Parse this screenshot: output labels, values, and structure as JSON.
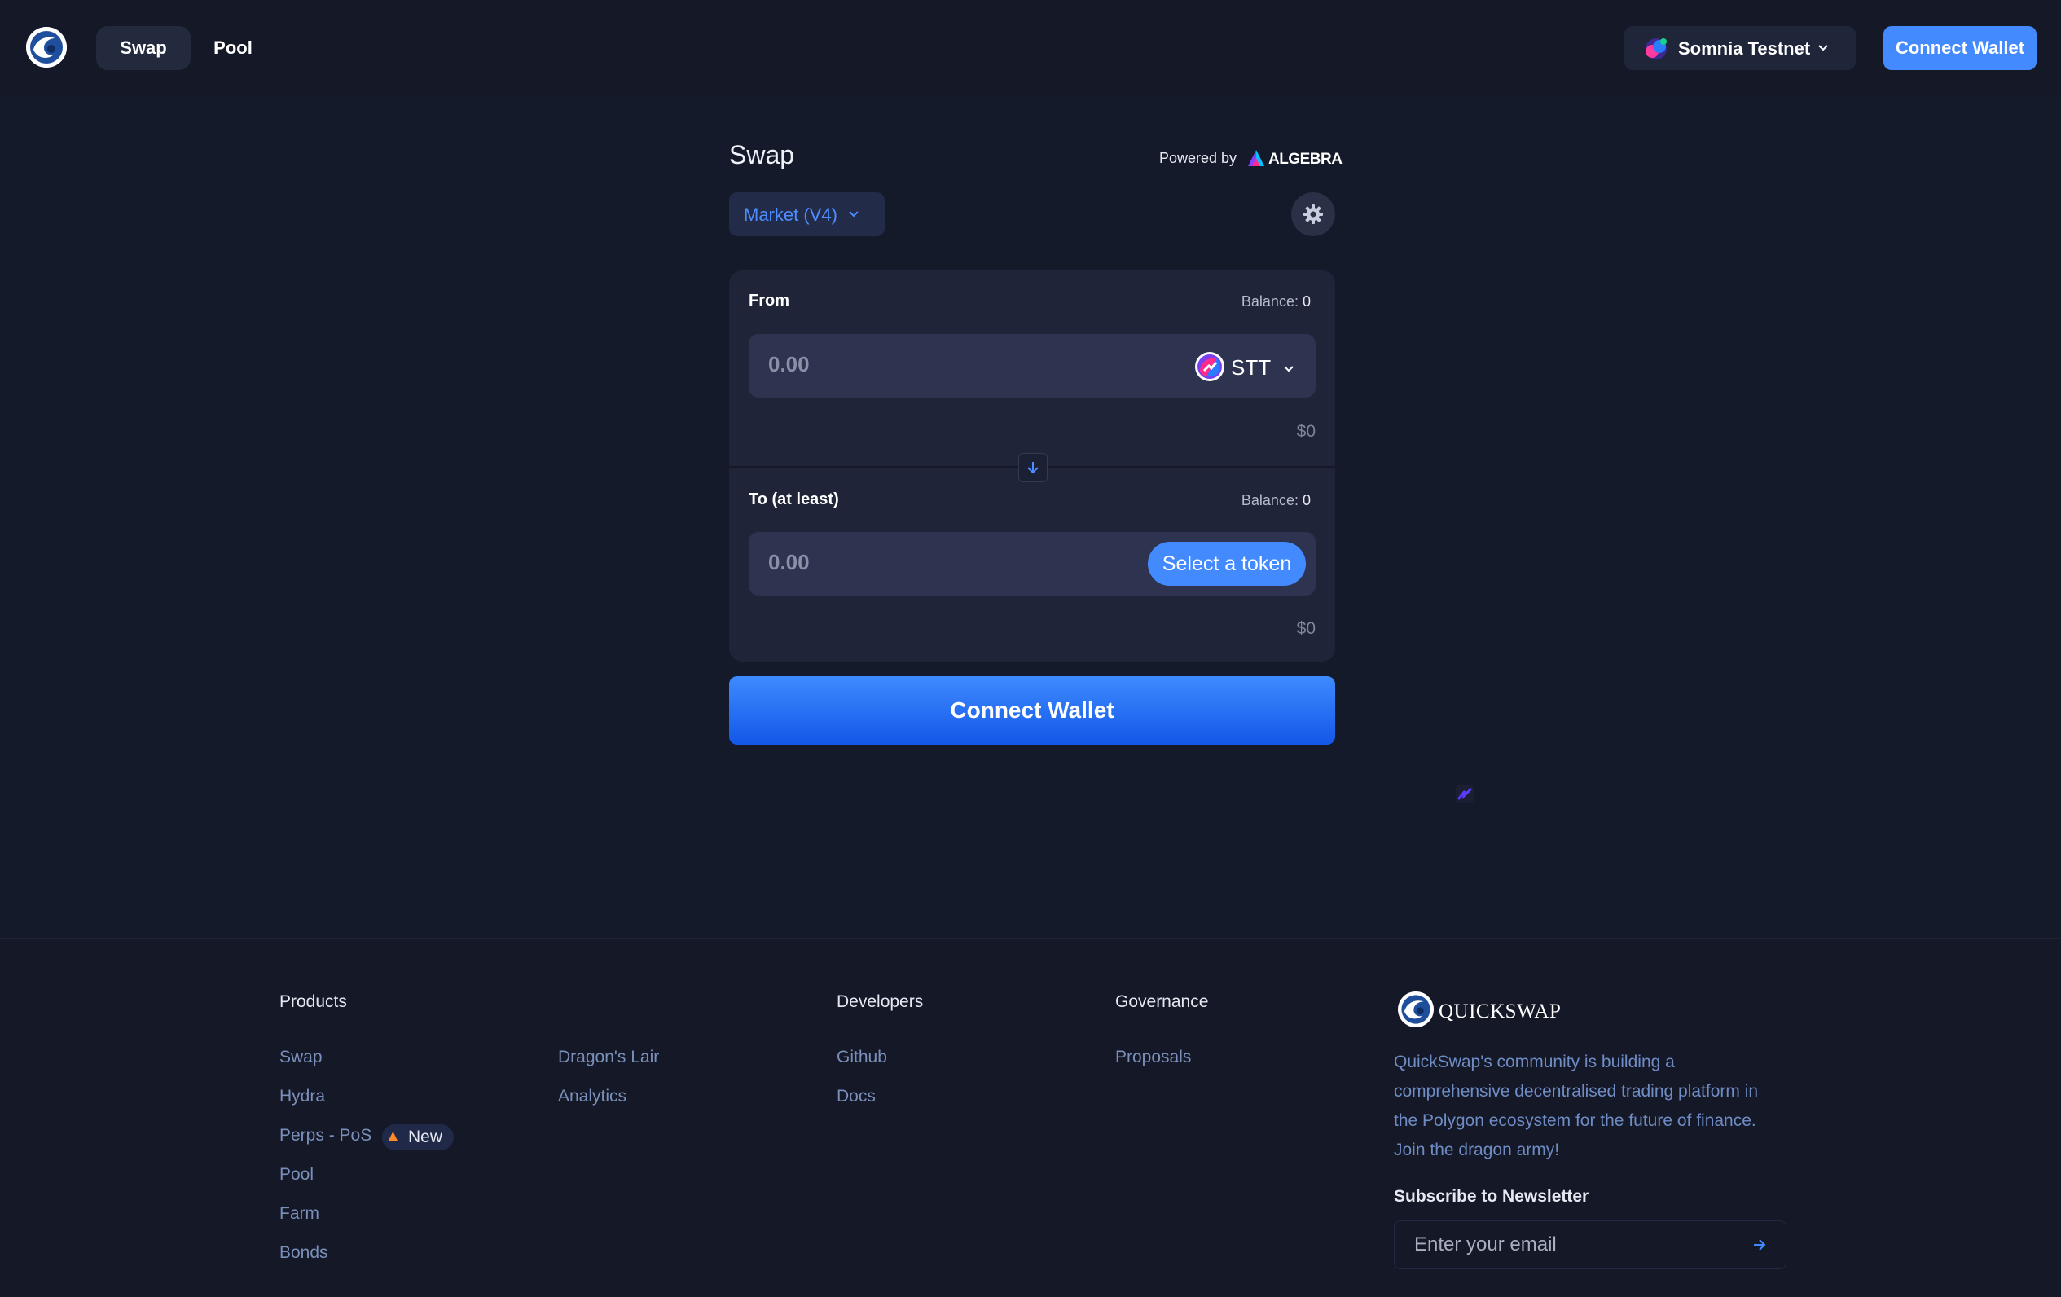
{
  "header": {
    "nav": [
      {
        "label": "Swap",
        "active": true
      },
      {
        "label": "Pool",
        "active": false
      }
    ],
    "network": {
      "label": "Somnia Testnet",
      "icon": "somnia-network-icon"
    },
    "connect_label": "Connect Wallet"
  },
  "swap": {
    "title": "Swap",
    "powered_by": "Powered by",
    "powered_brand": "ALGEBRA",
    "mode_label": "Market (V4)",
    "from": {
      "label": "From",
      "balance_label": "Balance:",
      "balance_value": "0",
      "amount_placeholder": "0.00",
      "token": "STT",
      "usd": "$0"
    },
    "to": {
      "label": "To (at least)",
      "balance_label": "Balance:",
      "balance_value": "0",
      "amount_placeholder": "0.00",
      "select_label": "Select a token",
      "usd": "$0"
    },
    "connect_label": "Connect Wallet"
  },
  "footer": {
    "products": {
      "heading": "Products",
      "links": [
        "Swap",
        "Hydra",
        "Perps - PoS",
        "Pool",
        "Farm",
        "Bonds"
      ],
      "links_col2": [
        "Dragon's Lair",
        "Analytics"
      ],
      "badge": "New"
    },
    "developers": {
      "heading": "Developers",
      "links": [
        "Github",
        "Docs"
      ]
    },
    "governance": {
      "heading": "Governance",
      "links": [
        "Proposals"
      ]
    },
    "brand": {
      "name": "QUICKSWAP",
      "description": "QuickSwap's community is building a comprehensive decentralised trading platform in the Polygon ecosystem for the future of finance. Join the dragon army!",
      "newsletter_label": "Subscribe to Newsletter",
      "email_placeholder": "Enter your email"
    }
  },
  "colors": {
    "background": "#151a2b",
    "header": "#141827",
    "accent": "#448aff",
    "card": "#1f2438",
    "input": "#2e3450",
    "footer_link": "#7a8fba"
  }
}
